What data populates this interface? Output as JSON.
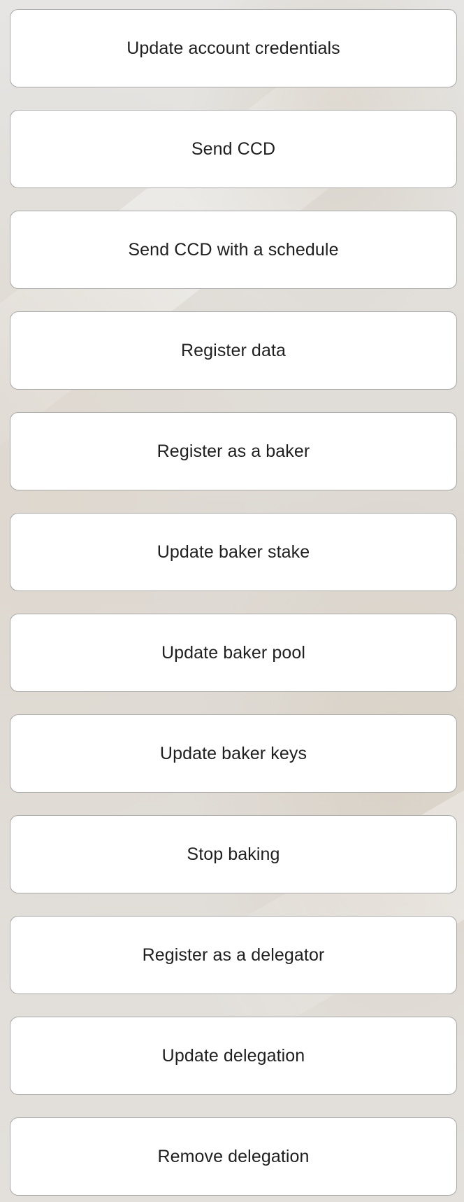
{
  "actions": [
    {
      "label": "Update account credentials"
    },
    {
      "label": "Send CCD"
    },
    {
      "label": "Send CCD with a schedule"
    },
    {
      "label": "Register data"
    },
    {
      "label": "Register as a baker"
    },
    {
      "label": "Update baker stake"
    },
    {
      "label": "Update baker pool"
    },
    {
      "label": "Update baker keys"
    },
    {
      "label": "Stop baking"
    },
    {
      "label": "Register as a delegator"
    },
    {
      "label": "Update delegation"
    },
    {
      "label": "Remove delegation"
    }
  ]
}
